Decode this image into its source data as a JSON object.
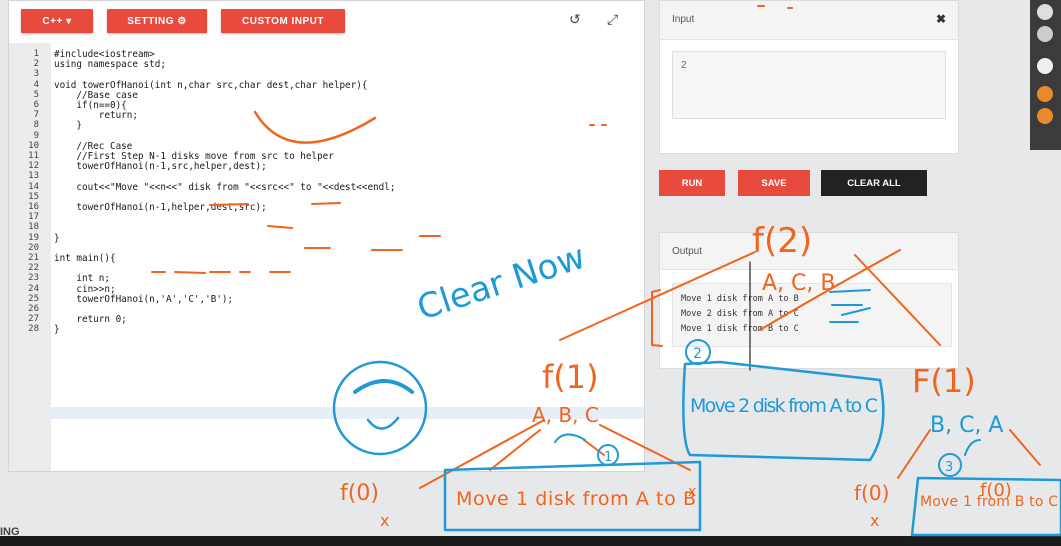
{
  "toolbar": {
    "lang_label": "C++ ▾",
    "setting_label": "SETTING ⚙",
    "custom_input_label": "CUSTOM INPUT",
    "reload_icon": "↺",
    "expand_icon": "⤢"
  },
  "code_lines": [
    "#include<iostream>",
    "using namespace std;",
    "",
    "void towerOfHanoi(int n,char src,char dest,char helper){",
    "    //Base case",
    "    if(n==0){",
    "        return;",
    "    }",
    "",
    "    //Rec Case",
    "    //First Step N-1 disks move from src to helper",
    "    towerOfHanoi(n-1,src,helper,dest);",
    "",
    "    cout<<\"Move \"<<n<<\" disk from \"<<src<<\" to \"<<dest<<endl;",
    "",
    "    towerOfHanoi(n-1,helper,dest,src);",
    "",
    "",
    "}",
    "",
    "int main(){",
    "",
    "    int n;",
    "    cin>>n;",
    "    towerOfHanoi(n,'A','C','B');",
    "",
    "    return 0;",
    "}"
  ],
  "line_numbers": [
    "1",
    "2",
    "3",
    "4",
    "5",
    "6",
    "7",
    "8",
    "9",
    "10",
    "11",
    "12",
    "13",
    "14",
    "15",
    "16",
    "17",
    "18",
    "19",
    "20",
    "21",
    "22",
    "23",
    "24",
    "25",
    "26",
    "27",
    "28"
  ],
  "input": {
    "title": "Input",
    "close_icon": "✖",
    "value": "2"
  },
  "actions": {
    "run": "RUN",
    "save": "SAVE",
    "clear": "CLEAR ALL"
  },
  "output": {
    "title": "Output",
    "lines": [
      "Move 1 disk from A to B",
      "Move 2 disk from A to C",
      "Move 1 disk from B to C"
    ]
  },
  "bottom_text": "ING",
  "annotations": {
    "clear_now": "Clear Now",
    "f2": "f(2)",
    "f2_args": "A, C, B",
    "f1_left": "f(1)",
    "f1_left_args": "A, B, C",
    "f1_right": "F(1)",
    "f1_right_args": "B, C, A",
    "f0": "f(0)",
    "move1": "Move 1 disk from A to B",
    "move2": "Move 2 disk from A to C",
    "move3": "Move 1 from B to C",
    "num1": "1",
    "num2": "2",
    "num3": "3",
    "x_mark": "x"
  },
  "colors": {
    "accent": "#e84a3d",
    "ink_orange": "#f0641e",
    "ink_blue": "#1f9ad6"
  }
}
